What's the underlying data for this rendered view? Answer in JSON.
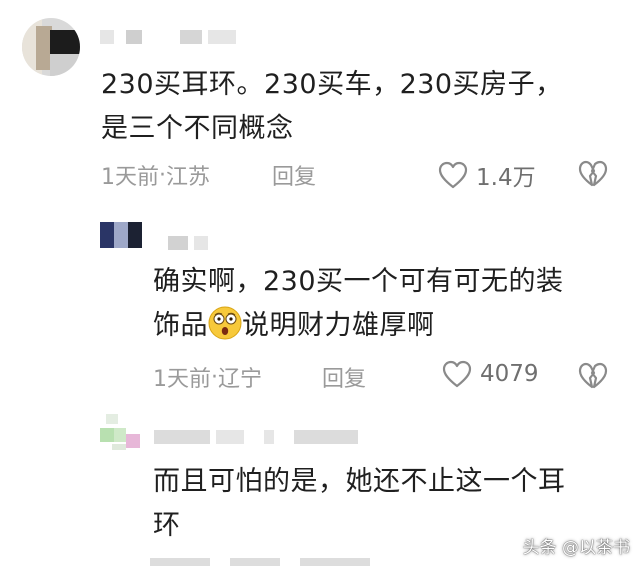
{
  "comments": [
    {
      "content": "230买耳环。230买车，230买房子，\n是三个不同概念",
      "time": "1天前",
      "location": "江苏",
      "reply": "回复",
      "likes": "1.4万"
    },
    {
      "content_line1": "确实啊，230买一个可有可无的装",
      "content_line2_before": "饰品",
      "content_line2_after": "说明财力雄厚啊",
      "time": "1天前",
      "location": "辽宁",
      "reply": "回复",
      "likes": "4079"
    },
    {
      "content": "而且可怕的是，她还不止这一个耳\n环"
    }
  ],
  "separator": " · ",
  "watermark": "头条 @以茶书",
  "colors": {
    "text": "#1f1f1f",
    "meta": "#9a9a9a",
    "icon": "#8a8a8a"
  },
  "icons": [
    "heart-outline-icon",
    "broken-heart-icon",
    "astonished-emoji-icon"
  ]
}
